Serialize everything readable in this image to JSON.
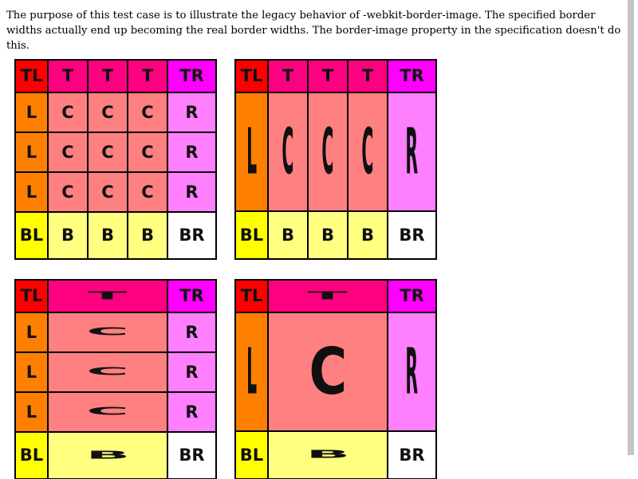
{
  "description": "The purpose of this test case is to illustrate the legacy behavior of -webkit-border-image. The specified border widths actually end up becoming the real border widths. The border-image property in the specification doesn't do this.",
  "labels": {
    "top_left": "TL",
    "top": "T",
    "top_right": "TR",
    "left": "L",
    "center": "C",
    "right": "R",
    "bottom_left": "BL",
    "bottom": "B",
    "bottom_right": "BR"
  },
  "colors": {
    "top_left": "#ff0000",
    "top": "#ff0080",
    "top_right": "#ff00ff",
    "left": "#ff8000",
    "center": "#ff8080",
    "right": "#ff80ff",
    "bottom_left": "#ffff00",
    "bottom": "#ffff80",
    "bottom_right": "#ffffff"
  }
}
